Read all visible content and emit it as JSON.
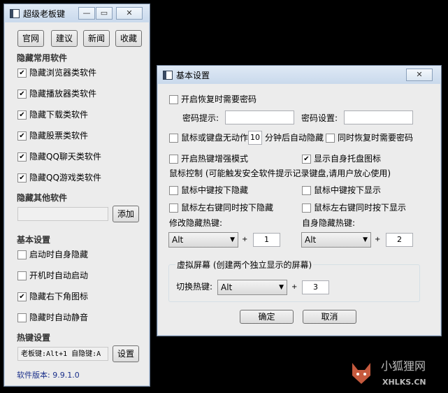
{
  "main_window": {
    "title": "超级老板键",
    "buttons": [
      "官网",
      "建议",
      "新闻",
      "收藏"
    ],
    "section_hide_common": "隐藏常用软件",
    "common_items": [
      {
        "label": "隐藏浏览器类软件",
        "checked": true
      },
      {
        "label": "隐藏播放器类软件",
        "checked": true
      },
      {
        "label": "隐藏下载类软件",
        "checked": true
      },
      {
        "label": "隐藏股票类软件",
        "checked": true
      },
      {
        "label": "隐藏QQ聊天类软件",
        "checked": true
      },
      {
        "label": "隐藏QQ游戏类软件",
        "checked": true
      }
    ],
    "section_hide_other": "隐藏其他软件",
    "add_label": "添加",
    "section_basic": "基本设置",
    "basic_items": [
      {
        "label": "启动时自身隐藏",
        "checked": false
      },
      {
        "label": "开机时自动启动",
        "checked": false
      },
      {
        "label": "隐藏右下角图标",
        "checked": true
      },
      {
        "label": "隐藏时自动静音",
        "checked": false
      }
    ],
    "section_hotkey": "热键设置",
    "hotkey_value": "老板键:Alt+1 自隐键:A",
    "settings_label": "设置",
    "version": "软件版本: 9.9.1.0"
  },
  "dialog": {
    "title": "基本设置",
    "require_password": "开启恢复时需要密码",
    "pw_hint_label": "密码提示:",
    "pw_set_label": "密码设置:",
    "idle_prefix": "鼠标或键盘无动作",
    "idle_minutes": "10",
    "idle_suffix": "分钟后自动隐藏",
    "idle_require_pw": "同时恢复时需要密码",
    "enhanced_hotkey": "开启热键增强模式",
    "show_tray": "显示自身托盘图标",
    "mouse_control": "鼠标控制 (可能触发安全软件提示记录键盘,请用户放心使用)",
    "mid_hide": "鼠标中键按下隐藏",
    "mid_show": "鼠标中键按下显示",
    "lr_hide": "鼠标左右键同时按下隐藏",
    "lr_show": "鼠标左右键同时按下显示",
    "modify_hide_hotkey": "修改隐藏热键:",
    "self_hide_hotkey": "自身隐藏热键:",
    "hide_mod": "Alt",
    "hide_key": "1",
    "self_mod": "Alt",
    "self_key": "2",
    "virtual_screen": "虚拟屏幕 (创建两个独立显示的屏幕)",
    "switch_hotkey": "切换热键:",
    "switch_mod": "Alt",
    "switch_key": "3",
    "ok": "确定",
    "cancel": "取消"
  },
  "watermark": {
    "cn": "小狐狸网",
    "en": "XHLKS.CN"
  }
}
